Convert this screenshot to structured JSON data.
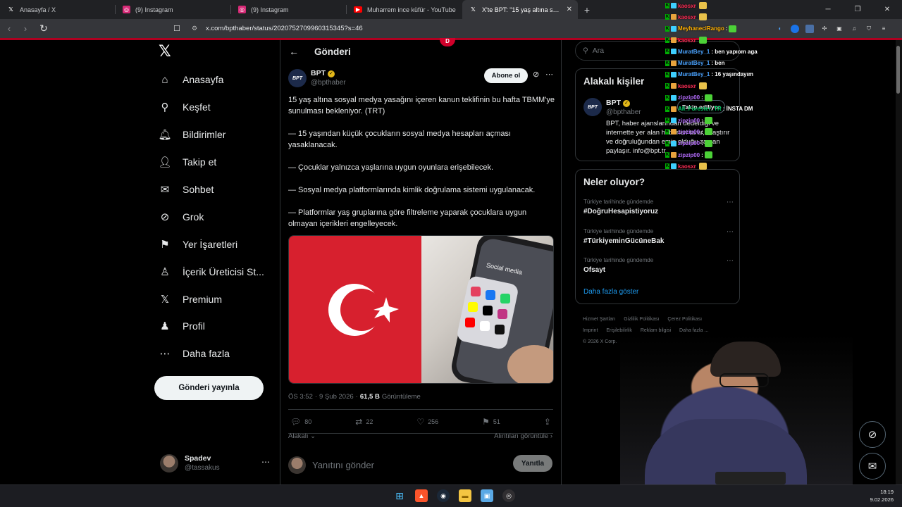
{
  "browser": {
    "tabs": [
      {
        "label": "Anasayfa / X",
        "icon": "x-logo-icon",
        "color": "#ffffff"
      },
      {
        "label": "(9) Instagram",
        "icon": "instagram-icon",
        "color": "#e1306c"
      },
      {
        "label": "(9) Instagram",
        "icon": "instagram-icon",
        "color": "#e1306c"
      },
      {
        "label": "Muharrem ince küfür - YouTube",
        "icon": "youtube-icon",
        "color": "#ff0000"
      },
      {
        "label": "X'te BPT: \"15 yaş altına sosyal me",
        "icon": "x-logo-icon",
        "color": "#ffffff",
        "active": true
      }
    ],
    "url": "x.com/bpthaber/status/2020752709960315345?s=46"
  },
  "nav": {
    "items": [
      {
        "label": "Anasayfa",
        "icon": "home-icon"
      },
      {
        "label": "Keşfet",
        "icon": "search-icon"
      },
      {
        "label": "Bildirimler",
        "icon": "bell-icon"
      },
      {
        "label": "Takip et",
        "icon": "add-user-icon"
      },
      {
        "label": "Sohbet",
        "icon": "envelope-icon"
      },
      {
        "label": "Grok",
        "icon": "grok-icon"
      },
      {
        "label": "Yer İşaretleri",
        "icon": "bookmark-icon"
      },
      {
        "label": "İçerik Üreticisi St...",
        "icon": "creator-studio-icon"
      },
      {
        "label": "Premium",
        "icon": "x-logo-icon"
      },
      {
        "label": "Profil",
        "icon": "profile-icon"
      },
      {
        "label": "Daha fazla",
        "icon": "more-circle-icon"
      }
    ],
    "post_button": "Gönderi yayınla",
    "account": {
      "name": "Spadev",
      "handle": "@tassakus"
    }
  },
  "post": {
    "header_title": "Gönderi",
    "author": {
      "name": "BPT",
      "handle": "@bpthaber",
      "logo_text": "BPT"
    },
    "subscribe_label": "Abone ol",
    "paragraphs": [
      "15 yaş altına sosyal medya yasağını içeren kanun teklifinin bu hafta TBMM'ye sunulması bekleniyor. (TRT)",
      "— 15 yaşından küçük çocukların sosyal medya hesapları açması yasaklanacak.",
      "— Çocuklar yalnızca yaşlarına uygun oyunlara erişebilecek.",
      "— Sosyal medya platformlarında kimlik doğrulama sistemi uygulanacak.",
      "— Platformlar yaş gruplarına göre filtreleme yaparak çocuklara uygun olmayan içerikleri engelleyecek."
    ],
    "media": {
      "flag_color": "#d7202e",
      "phone_label": "Social media"
    },
    "time": "ÖS 3:52",
    "date": "9 Şub 2026",
    "views": "61,5 B",
    "views_label": "Görüntüleme",
    "stats": {
      "replies": "80",
      "reposts": "22",
      "likes": "256",
      "bookmarks": "51"
    },
    "related_label": "Alakalı",
    "quotes_label": "Alıntıları görüntüle",
    "reply_placeholder": "Yanıtını gönder",
    "reply_button": "Yanıtla"
  },
  "sidebar": {
    "search_placeholder": "Ara",
    "related_title": "Alakalı kişiler",
    "related_person": {
      "name": "BPT",
      "handle": "@bpthaber",
      "follow_state": "Takip ediliyor",
      "bio": "BPT, haber ajanslarından dedeldiği ve internette yer alan haberleri tarar, araştırır ve doğruluğundan emin olduğu zaman paylaşır. info@bpt.tr"
    },
    "trends_title": "Neler oluyor?",
    "trends": [
      {
        "context": "Türkiye tarihinde gündemde",
        "tag": "#DoğruHesapistiyoruz"
      },
      {
        "context": "Türkiye tarihinde gündemde",
        "tag": "#TürkiyeminGücüneBak"
      },
      {
        "context": "Türkiye tarihinde gündemde",
        "tag": "Ofsayt"
      }
    ],
    "show_more": "Daha fazla göster",
    "footer_links": [
      "Hizmet Şartları",
      "Gizlilik Politikası",
      "Çerez Politikası",
      "Imprint",
      "Erişilebilirlik",
      "Reklam bilgisi",
      "Daha fazla ..."
    ],
    "copyright": "© 2026 X Corp."
  },
  "chat": [
    {
      "name": "kaosxr",
      "msg": "",
      "color": "#ff2d55",
      "emote": "#e8c14a"
    },
    {
      "name": "kaosxr",
      "msg": "",
      "color": "#ff2d55",
      "emote": "#e8c14a"
    },
    {
      "name": "MeyhaneciRango",
      "msg": ":",
      "color": "#ffb000",
      "emote": "#4cd137"
    },
    {
      "name": "kaosxr",
      "msg": "",
      "color": "#ff2d55",
      "emote": "#4cd137"
    },
    {
      "name": "MuratBey_1",
      "msg": ": ben yapıom aga",
      "color": "#4aa3ff",
      "emote": ""
    },
    {
      "name": "MuratBey_1",
      "msg": ": ben",
      "color": "#4aa3ff",
      "emote": ""
    },
    {
      "name": "MuratBey_1",
      "msg": ": 16 yaşındayım",
      "color": "#4aa3ff",
      "emote": ""
    },
    {
      "name": "kaosxr",
      "msg": "",
      "color": "#ff2d55",
      "emote": "#e8c14a"
    },
    {
      "name": "zipzip00",
      "msg": ":",
      "color": "#b66dff",
      "emote": "#4cd137"
    },
    {
      "name": "Ali_Forester_TR",
      "msg": ": İNSTA DM",
      "color": "#00d26a",
      "emote": ""
    },
    {
      "name": "zipzip00",
      "msg": ":",
      "color": "#b66dff",
      "emote": "#4cd137"
    },
    {
      "name": "zipzip00",
      "msg": ":",
      "color": "#b66dff",
      "emote": "#4cd137"
    },
    {
      "name": "zipzip00",
      "msg": ":",
      "color": "#b66dff",
      "emote": "#4cd137"
    },
    {
      "name": "zipzip00",
      "msg": ":",
      "color": "#b66dff",
      "emote": "#4cd137"
    },
    {
      "name": "kaosxr",
      "msg": "",
      "color": "#ff2d55",
      "emote": "#e8c14a"
    }
  ],
  "taskbar": {
    "time": "18:19",
    "date": "9.02.2026"
  }
}
